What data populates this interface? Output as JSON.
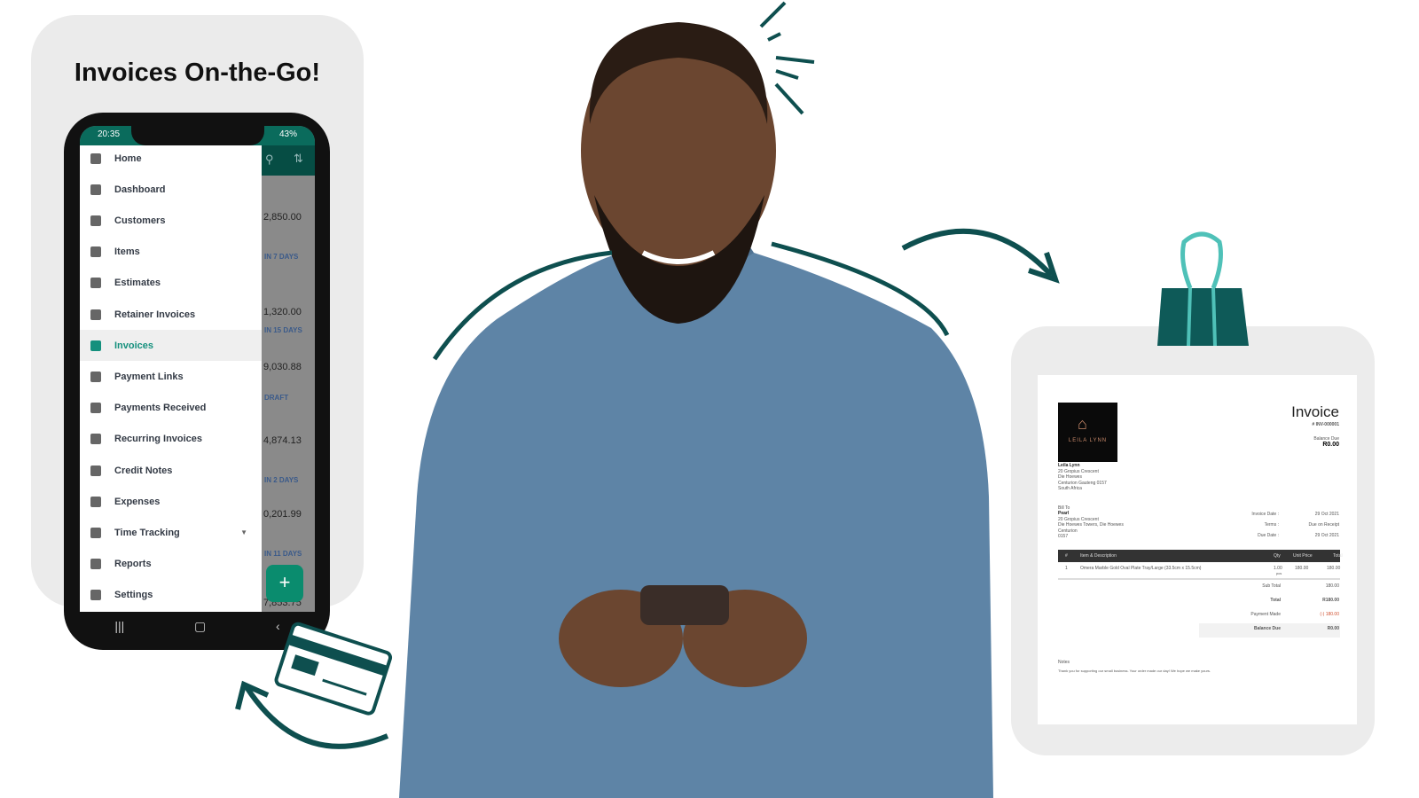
{
  "headline": "Invoices On-the-Go!",
  "phone": {
    "status_time": "20:35",
    "status_battery": "43%",
    "menu": [
      {
        "label": "Home",
        "icon": "home-icon"
      },
      {
        "label": "Dashboard",
        "icon": "dashboard-icon"
      },
      {
        "label": "Customers",
        "icon": "person-icon"
      },
      {
        "label": "Items",
        "icon": "basket-icon"
      },
      {
        "label": "Estimates",
        "icon": "estimate-icon"
      },
      {
        "label": "Retainer Invoices",
        "icon": "document-icon"
      },
      {
        "label": "Invoices",
        "icon": "invoice-icon",
        "active": true
      },
      {
        "label": "Payment Links",
        "icon": "link-icon"
      },
      {
        "label": "Payments Received",
        "icon": "payment-icon"
      },
      {
        "label": "Recurring Invoices",
        "icon": "recurring-icon"
      },
      {
        "label": "Credit Notes",
        "icon": "credit-note-icon"
      },
      {
        "label": "Expenses",
        "icon": "expense-icon"
      },
      {
        "label": "Time Tracking",
        "icon": "clock-icon"
      },
      {
        "label": "Reports",
        "icon": "chart-icon"
      },
      {
        "label": "Settings",
        "icon": "gear-icon"
      }
    ],
    "background_list": [
      {
        "amount": "2,850.00",
        "status": "IN 7 DAYS"
      },
      {
        "amount": "1,320.00",
        "status": "IN 15 DAYS"
      },
      {
        "amount": "9,030.88",
        "status": "DRAFT"
      },
      {
        "amount": "4,874.13",
        "status": "IN 2 DAYS"
      },
      {
        "amount": "0,201.99",
        "status": "IN 11 DAYS"
      },
      {
        "amount": "7,853.75",
        "status": ""
      }
    ],
    "fab": "+"
  },
  "invoice": {
    "logo_text": "LEILA LYNN",
    "title": "Invoice",
    "number": "# INV-000001",
    "balance_due_label": "Balance Due",
    "balance_due_value": "R0.00",
    "from": [
      "Leila Lynn",
      "20 Gropius Crescent",
      "Die Hoewes",
      "Centurion Gauteng 0157",
      "South Africa"
    ],
    "bill_to_label": "Bill To",
    "bill_to": [
      "Pearl",
      "20 Gropius Crescent",
      "Die Hoewes Towers, Die Hoewes",
      "Centurion",
      "0157"
    ],
    "meta": [
      {
        "label": "Invoice Date :",
        "value": "29 Oct 2021"
      },
      {
        "label": "Terms :",
        "value": "Due on Receipt"
      },
      {
        "label": "Due Date :",
        "value": "29 Oct 2021"
      }
    ],
    "table_headers": [
      "#",
      "Item & Description",
      "Qty",
      "Unit Price",
      "Total"
    ],
    "rows": [
      {
        "n": "1",
        "desc": "Omera Marble Gold Oval Plate Tray/Large (33.5cm x 15.5cm)",
        "qty": "1.00",
        "unit": "pcs",
        "price": "180.00",
        "total": "180.00"
      }
    ],
    "totals": [
      {
        "label": "Sub Total",
        "value": "180.00"
      },
      {
        "label": "Total",
        "value": "R180.00"
      },
      {
        "label": "Payment Made",
        "value": "(-) 180.00"
      },
      {
        "label": "Balance Due",
        "value": "R0.00"
      }
    ],
    "notes_label": "Notes",
    "notes": "Thank you for supporting our small business. Your order made our day! We hope we make yours."
  },
  "colors": {
    "teal": "#0e4f4f",
    "accent": "#14907d",
    "shirt": "#5e84a6"
  }
}
